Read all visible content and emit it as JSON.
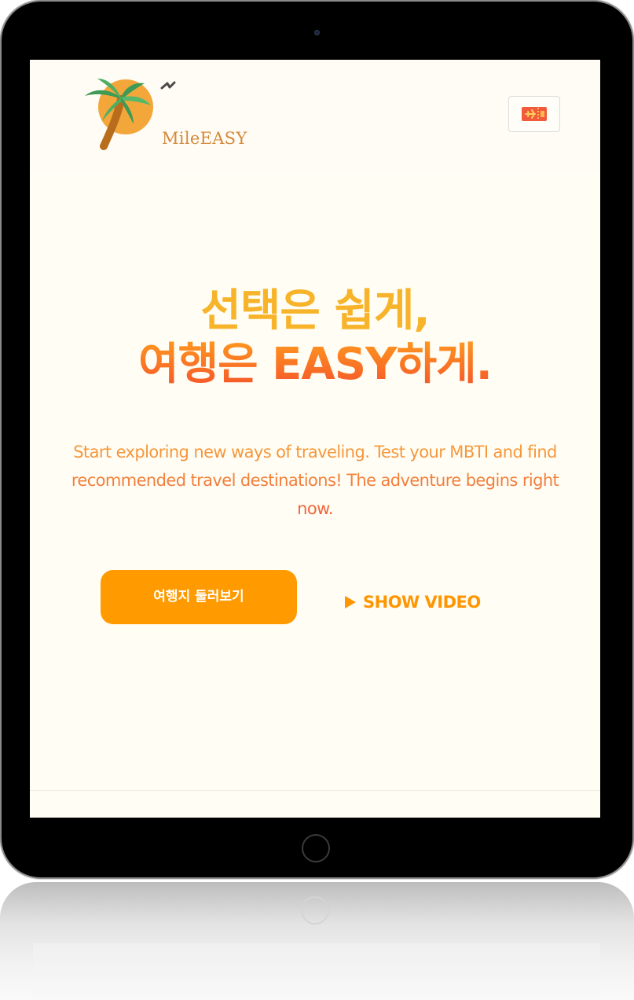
{
  "brand": {
    "name": "MileEASY"
  },
  "header": {
    "ticket_icon": "plane-ticket-icon"
  },
  "hero": {
    "headline_line1": "선택은 쉽게,",
    "headline_line2": "여행은 EASY하게.",
    "subtitle": "Start exploring new ways of traveling. Test your MBTI and find recommended travel destinations! The adventure begins right now.",
    "primary_button_label": "여행지 둘러보기",
    "video_link_label": "SHOW VIDEO",
    "video_icon": "play-icon"
  },
  "colors": {
    "accent_orange": "#ff9b00",
    "headline_yellow": "#f7b42a",
    "headline_red": "#f4512b",
    "screen_background": "#fffdf4"
  }
}
